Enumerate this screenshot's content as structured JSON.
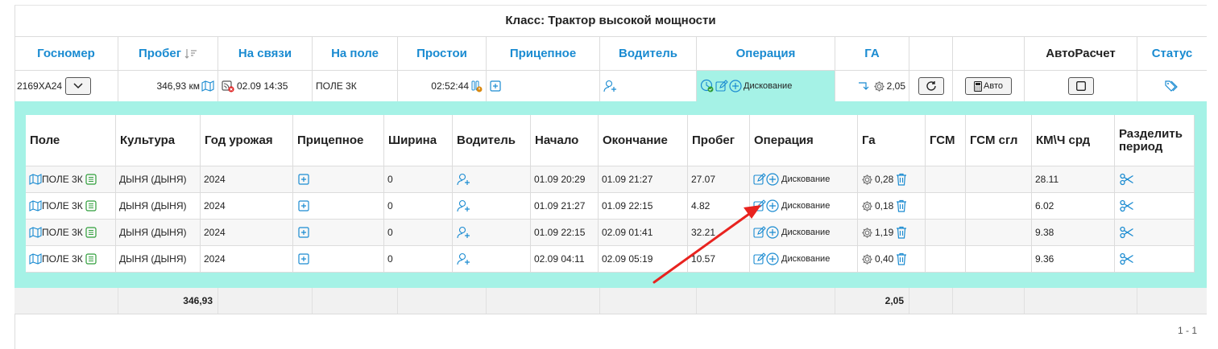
{
  "class_title": "Класс: Трактор высокой мощности",
  "main_headers": [
    {
      "label": "Госномер"
    },
    {
      "label": "Пробег"
    },
    {
      "label": "На связи"
    },
    {
      "label": "На поле"
    },
    {
      "label": "Простои"
    },
    {
      "label": "Прицепное"
    },
    {
      "label": "Водитель"
    },
    {
      "label": "Операция"
    },
    {
      "label": "ГА"
    },
    {
      "label": ""
    },
    {
      "label": ""
    },
    {
      "label": "АвтоРасчет"
    },
    {
      "label": "Статус"
    }
  ],
  "vehicle": {
    "plate": "2169ХА24",
    "mileage": "346,93 км",
    "online": "02.09 14:35",
    "field": "ПОЛЕ 3К",
    "downtime": "02:52:44",
    "operation": "Дискование",
    "ha": "2,05",
    "auto_label": "Авто"
  },
  "sub_headers": [
    "Поле",
    "Культура",
    "Год урожая",
    "Прицепное",
    "Ширина",
    "Водитель",
    "Начало",
    "Окончание",
    "Пробег",
    "Операция",
    "Га",
    "ГСМ",
    "ГСМ сгл",
    "КМ\\Ч срд",
    "Разделить период"
  ],
  "sub_rows": [
    {
      "field": "ПОЛЕ 3К",
      "crop": "ДЫНЯ (ДЫНЯ)",
      "year": "2024",
      "width": "0",
      "start": "01.09 20:29",
      "end": "01.09 21:27",
      "mileage": "27.07",
      "operation": "Дискование",
      "ha": "0,28",
      "fuel": "",
      "fuel_smooth": "",
      "kmh": "28.11"
    },
    {
      "field": "ПОЛЕ 3К",
      "crop": "ДЫНЯ (ДЫНЯ)",
      "year": "2024",
      "width": "0",
      "start": "01.09 21:27",
      "end": "01.09 22:15",
      "mileage": "4.82",
      "operation": "Дискование",
      "ha": "0,18",
      "fuel": "",
      "fuel_smooth": "",
      "kmh": "6.02"
    },
    {
      "field": "ПОЛЕ 3К",
      "crop": "ДЫНЯ (ДЫНЯ)",
      "year": "2024",
      "width": "0",
      "start": "01.09 22:15",
      "end": "02.09 01:41",
      "mileage": "32.21",
      "operation": "Дискование",
      "ha": "1,19",
      "fuel": "",
      "fuel_smooth": "",
      "kmh": "9.38"
    },
    {
      "field": "ПОЛЕ 3К",
      "crop": "ДЫНЯ (ДЫНЯ)",
      "year": "2024",
      "width": "0",
      "start": "02.09 04:11",
      "end": "02.09 05:19",
      "mileage": "10.57",
      "operation": "Дискование",
      "ha": "0,40",
      "fuel": "",
      "fuel_smooth": "",
      "kmh": "9.36"
    }
  ],
  "totals": {
    "mileage": "346,93",
    "ha": "2,05"
  },
  "pager": "1 - 1",
  "colors": {
    "accent": "#1a8bd1",
    "detail_bg": "#a5f2e6",
    "arrow": "#e8231f",
    "success": "#2e9e3a",
    "error": "#e02424"
  }
}
